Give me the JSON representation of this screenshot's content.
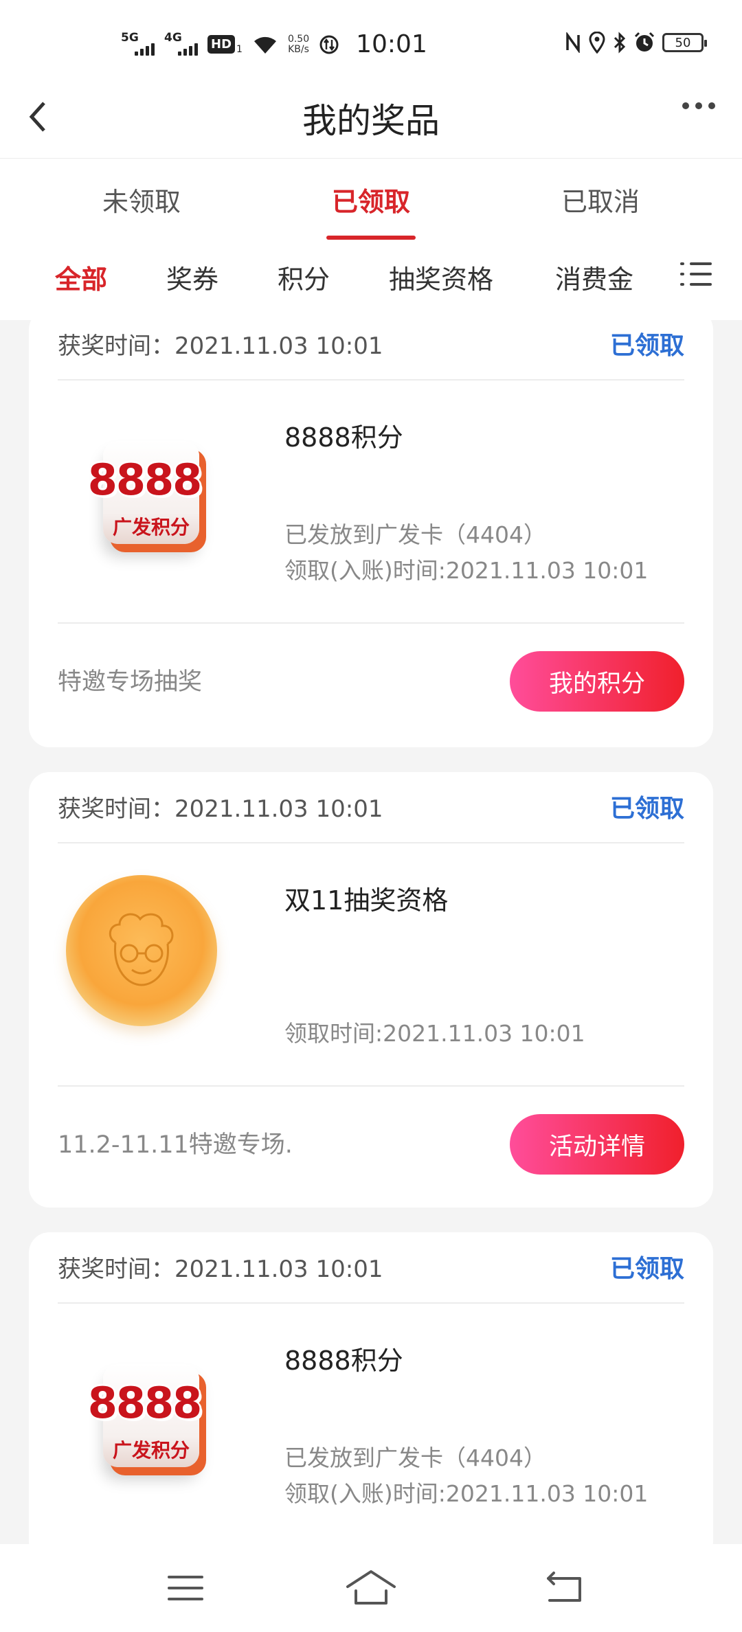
{
  "status_bar": {
    "sig1": "5G",
    "sig2": "4G",
    "hd": "HD",
    "hd_sub": "1",
    "speed_value": "0.50",
    "speed_unit": "KB/s",
    "time": "10:01",
    "battery": "50"
  },
  "header": {
    "title": "我的奖品"
  },
  "tabs": [
    {
      "label": "未领取"
    },
    {
      "label": "已领取"
    },
    {
      "label": "已取消"
    }
  ],
  "categories": [
    {
      "label": "全部"
    },
    {
      "label": "奖券"
    },
    {
      "label": "积分"
    },
    {
      "label": "抽奖资格"
    },
    {
      "label": "消费金"
    }
  ],
  "cards": [
    {
      "time": "获奖时间：2021.11.03 10:01",
      "status": "已领取",
      "image_num": "8888",
      "image_label": "广发积分",
      "name": "8888积分",
      "info1": "已发放到广发卡（4404）",
      "info2": "领取(入账)时间:2021.11.03 10:01",
      "desc": "特邀专场抽奖",
      "button": "我的积分"
    },
    {
      "time": "获奖时间：2021.11.03 10:01",
      "status": "已领取",
      "name": "双11抽奖资格",
      "info2": "领取时间:2021.11.03 10:01",
      "desc": "11.2-11.11特邀专场.",
      "button": "活动详情"
    },
    {
      "time": "获奖时间：2021.11.03 10:01",
      "status": "已领取",
      "image_num": "8888",
      "image_label": "广发积分",
      "name": "8888积分",
      "info1": "已发放到广发卡（4404）",
      "info2": "领取(入账)时间:2021.11.03 10:01"
    }
  ],
  "colors": {
    "accent": "#d8252a",
    "status_blue": "#2d6fd4",
    "button_gradient_start": "#ff4d9a",
    "button_gradient_end": "#f0202c"
  }
}
